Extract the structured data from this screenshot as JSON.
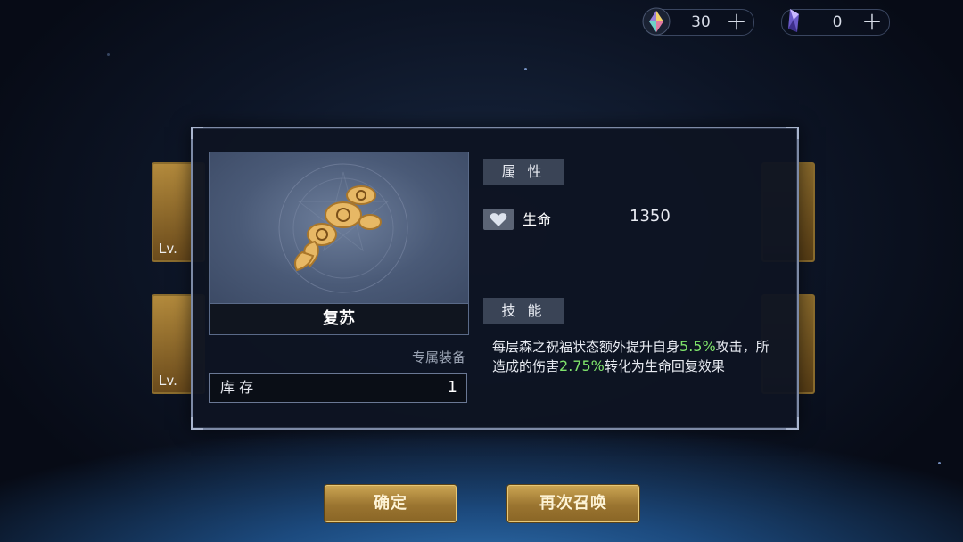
{
  "currency": {
    "gem": {
      "icon": "rainbow-gem-icon",
      "value": "30"
    },
    "crystal": {
      "icon": "purple-crystal-icon",
      "value": "0"
    }
  },
  "background_cards": {
    "level_label": "Lv."
  },
  "item": {
    "name": "复苏",
    "tag": "专属装备",
    "stock_label": "库 存",
    "stock_value": "1"
  },
  "attributes": {
    "header": "属 性",
    "rows": [
      {
        "icon": "heart-icon",
        "name": "生命",
        "value": "1350"
      }
    ]
  },
  "skill": {
    "header": "技 能",
    "text_1": "每层森之祝福状态额外提升自身",
    "value_1": "5.5%",
    "text_2": "攻击，所造成的伤害",
    "value_2": "2.75%",
    "text_3": "转化为生命回复效果",
    "highlight_color": "#7fe36b"
  },
  "buttons": {
    "confirm": "确定",
    "summon_again": "再次召唤"
  }
}
